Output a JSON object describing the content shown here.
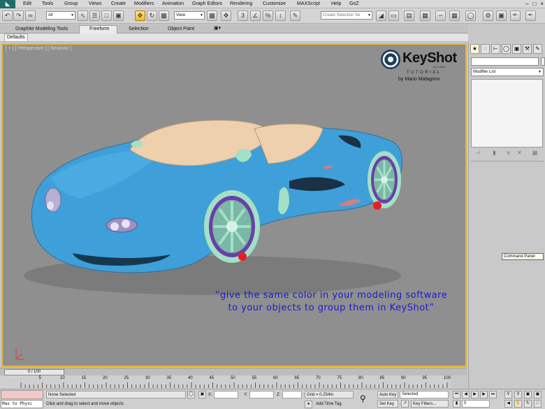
{
  "menu": {
    "items": [
      "Edit",
      "Tools",
      "Group",
      "Views",
      "Create",
      "Modifiers",
      "Animation",
      "Graph Editors",
      "Rendering",
      "Customize",
      "MAXScript",
      "Help",
      "GoZ"
    ],
    "logo": "◣"
  },
  "toolbar": {
    "selection_filter": "All",
    "reference_coord": "View",
    "named_selection_placeholder": "Create Selection Se",
    "icons": [
      "undo-icon",
      "redo-icon",
      "select-link-icon",
      "unlink-icon",
      "bind-spacewarp-icon",
      "select-object-icon",
      "select-by-name-icon",
      "rect-selection-icon",
      "window-crossing-icon",
      "select-move-icon",
      "select-rotate-icon",
      "select-scale-icon",
      "pivot-icon",
      "manipulate-icon",
      "snaps-icon",
      "angle-snap-icon",
      "percent-snap-icon",
      "spinner-snap-icon",
      "mirror-icon",
      "align-icon",
      "layer-manager-icon",
      "graphite-toggle-icon",
      "curve-editor-icon",
      "schematic-view-icon",
      "material-editor-icon",
      "render-setup-icon",
      "rendered-frame-icon",
      "render-icon"
    ]
  },
  "ribbon": {
    "tabs": [
      "Graphite Modeling Tools",
      "Freeform",
      "Selection",
      "Object Paint"
    ],
    "active_tab": "Freeform",
    "subtab": "Defaults"
  },
  "viewport": {
    "label": "[ + ] [ Perspective ] [ Realistic ]",
    "logo_title": "KeyShot",
    "logo_by": "by Luxion",
    "logo_subtitle": "TUTORIAL",
    "logo_author": "by Mario Malagrino",
    "caption_line1": "“give the same color in your modeling software",
    "caption_line2": "to your objects to group them in KeyShot”"
  },
  "colors": {
    "car_body": "#3f9fd8",
    "car_cabin": "#eed0ad",
    "wheel_rim": "#a3e0c6",
    "wheel_tire": "#6a3fa8",
    "viewport_bg": "#8f8f8f",
    "active_border": "#e5b63a",
    "caption": "#1a1ad8"
  },
  "command_panel": {
    "tabs": [
      "create-icon",
      "modify-icon",
      "hierarchy-icon",
      "motion-icon",
      "display-icon",
      "utilities-icon"
    ],
    "modifier_list": "Modifier List",
    "tooltip": "Command Panel"
  },
  "timeline": {
    "slider_text": "0 / 100",
    "ticks": [
      "5",
      "10",
      "15",
      "20",
      "25",
      "30",
      "35",
      "40",
      "45",
      "50",
      "55",
      "60",
      "65",
      "70",
      "75",
      "80",
      "85",
      "90",
      "95",
      "100"
    ]
  },
  "status": {
    "maxscript_text": "Max to Physc",
    "selection_text": "None Selected",
    "prompt_text": "Click and drag to select and move objects",
    "x_label": "X:",
    "y_label": "Y:",
    "z_label": "Z:",
    "grid": "Grid = 0.254m",
    "add_time_tag": "Add Time Tag",
    "auto_key": "Auto Key",
    "set_key": "Set Key",
    "key_mode_select": "Selected",
    "key_filters": "Key Filters...",
    "frame_value": "0"
  }
}
